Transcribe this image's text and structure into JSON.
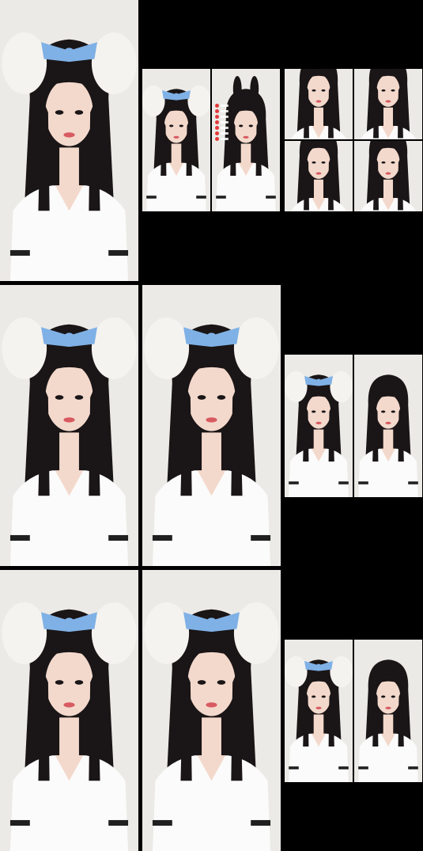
{
  "palette": {
    "background": "#000000",
    "wall": "#eceae6",
    "skin": "#f3d9cc",
    "hair": "#1a1516",
    "bow": "#7fb1e6",
    "ears": "#f5f3ef",
    "top_white": "#fbfbfb",
    "stripe": "#202020",
    "lip": "#d85b62"
  },
  "tiles": [
    {
      "name": "frame-1",
      "variant": "bunny-ears"
    },
    {
      "name": "frame-2a",
      "variant": "bunny-ears"
    },
    {
      "name": "frame-2b",
      "variant": "black-bunny"
    },
    {
      "name": "frame-3a",
      "variant": "plain"
    },
    {
      "name": "frame-3b",
      "variant": "plain"
    },
    {
      "name": "frame-3c",
      "variant": "black-bunny"
    },
    {
      "name": "frame-3d",
      "variant": "plain"
    },
    {
      "name": "frame-4",
      "variant": "bunny-ears"
    },
    {
      "name": "frame-5",
      "variant": "bunny-ears"
    },
    {
      "name": "frame-6a",
      "variant": "bunny-ears"
    },
    {
      "name": "frame-6b",
      "variant": "plain"
    },
    {
      "name": "frame-7",
      "variant": "bunny-ears"
    },
    {
      "name": "frame-8",
      "variant": "bunny-ears"
    },
    {
      "name": "frame-9a",
      "variant": "bunny-ears"
    },
    {
      "name": "frame-9b",
      "variant": "plain"
    }
  ]
}
